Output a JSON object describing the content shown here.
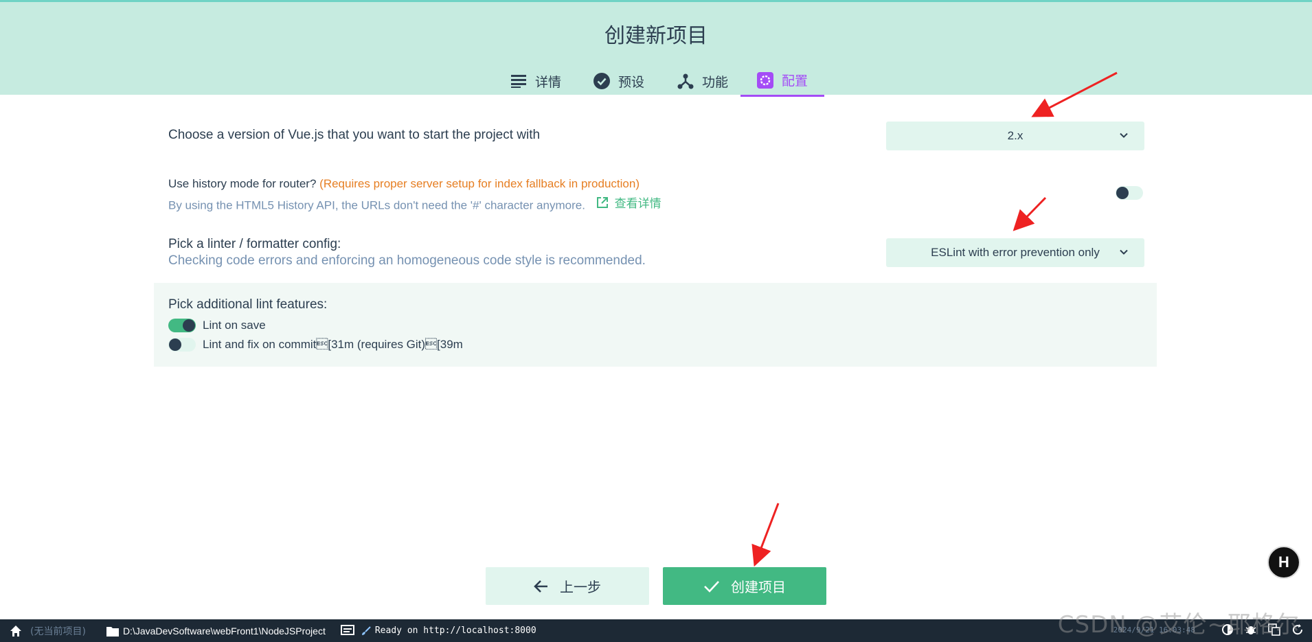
{
  "header": {
    "title": "创建新项目",
    "tabs": [
      {
        "label": "详情",
        "icon": "list-icon"
      },
      {
        "label": "预设",
        "icon": "check-circle-icon"
      },
      {
        "label": "功能",
        "icon": "fork-icon"
      },
      {
        "label": "配置",
        "icon": "gear-icon",
        "active": true
      }
    ]
  },
  "vue_version": {
    "label": "Choose a version of Vue.js that you want to start the project with",
    "value": "2.x"
  },
  "history_mode": {
    "label": "Use history mode for router?",
    "warning": "(Requires proper server setup for index fallback in production)",
    "description": "By using the HTML5 History API, the URLs don't need the '#' character anymore.",
    "link": "查看详情",
    "enabled": false
  },
  "linter": {
    "label": "Pick a linter / formatter config:",
    "description": "Checking code errors and enforcing an homogeneous code style is recommended.",
    "value": "ESLint with error prevention only"
  },
  "lint_features": {
    "label": "Pick additional lint features:",
    "options": [
      {
        "label": "Lint on save",
        "enabled": true
      },
      {
        "label": "Lint and fix on commit\u001b[31m (requires Git)\u001b[39m",
        "enabled": false
      }
    ]
  },
  "buttons": {
    "prev": "上一步",
    "create": "创建项目"
  },
  "statusbar": {
    "no_project": "(无当前项目)",
    "path": "D:\\JavaDevSoftware\\webFront1\\NodeJSProject",
    "status": "Ready on http://localhost:8000",
    "clock": "2024/9/21 16:03:48"
  },
  "watermark": "CSDN @艾伦~耶格尔",
  "colors": {
    "accent": "#42b983",
    "active_tab": "#a44cf6",
    "header_bg": "#c6ebe0",
    "warning": "#e67e22",
    "statusbar_bg": "#1d2935"
  }
}
